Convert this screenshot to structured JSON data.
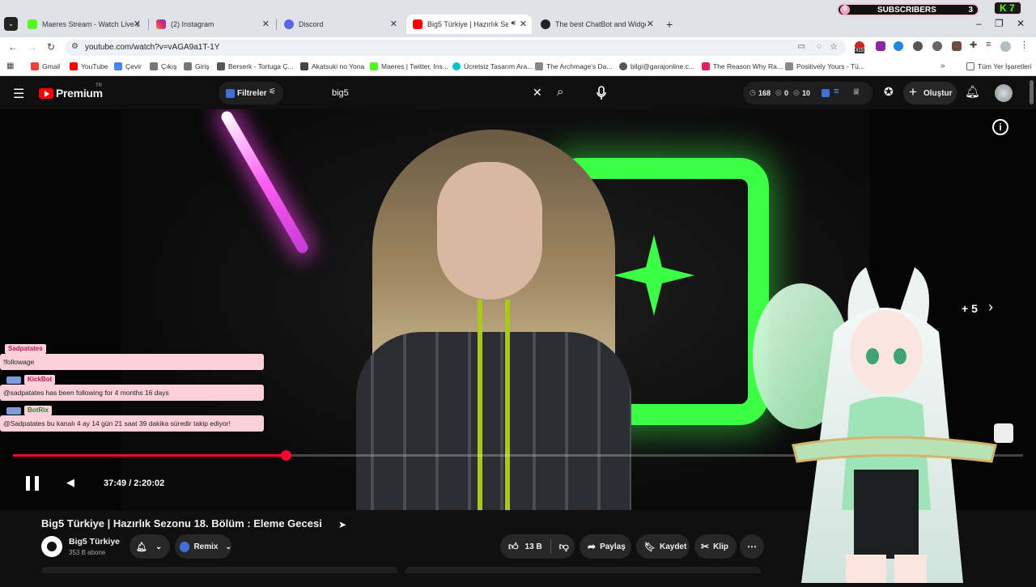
{
  "browser": {
    "tabs": [
      {
        "title": "Maeres Stream - Watch Live on",
        "color": "#53fc18"
      },
      {
        "title": "(2) Instagram",
        "color": "#e1306c"
      },
      {
        "title": "Discord",
        "color": "#5865f2"
      },
      {
        "title": "Big5 Türkiye | Hazırlık Sezon",
        "color": "#ff0000"
      },
      {
        "title": "The best ChatBot and Widgets",
        "color": "#222222"
      }
    ],
    "new_tab": "+",
    "url": "youtube.com/watch?v=vAGA9a1T-1Y",
    "bookmarks": [
      "Gmail",
      "YouTube",
      "Çevir",
      "Çıkış",
      "Giriş",
      "Berserk - Tortuga Ç...",
      "Akatsuki no Yona",
      "Maeres | Twitter, Ins...",
      "Ücretsiz Tasarım Ara...",
      "The Archmage's Da...",
      "bilgi@garajonline.c...",
      "The Reason Why Ra...",
      "Positively Yours - Tü..."
    ],
    "bookmarks_more": "»",
    "all_bookmarks": "Tüm Yer İşaretleri",
    "ext_badge": "415"
  },
  "widget": {
    "count_left": "0",
    "label": "SUBSCRIBERS",
    "count_right": "3",
    "kick_label": "K 7"
  },
  "yt": {
    "logo_text": "Premium",
    "logo_sup": "TR",
    "filters_label": "Filtreler",
    "search_value": "big5",
    "stats": {
      "a": "168",
      "b": "0",
      "c": "10"
    },
    "create_label": "Oluştur"
  },
  "chat": [
    {
      "name": "Sadpatates",
      "msg": "!followage"
    },
    {
      "name": "KickBot",
      "msg": "@sadpatates has been following for 4 months 16 days"
    },
    {
      "name": "BotRix",
      "msg": "@Sadpatates bu kanalı 4 ay 14 gün 21 saat 39 dakika süredir takip ediyor!"
    }
  ],
  "player": {
    "time": "37:49 / 2:20:02",
    "progress": 0.27,
    "more_label": "+ 5"
  },
  "video": {
    "title": "Big5 Türkiye | Hazırlık Sezonu 18. Bölüm : Eleme Gecesi",
    "channel": "Big5 Türkiye",
    "subs": "353 B abone",
    "remix_label": "Remix",
    "likes": "13 B",
    "share_label": "Paylaş",
    "save_label": "Kaydet",
    "clip_label": "Klip"
  },
  "colors": {
    "accent": "#ff0033",
    "chat_bg": "#fbd0d9",
    "neon_green": "#3bff44"
  }
}
